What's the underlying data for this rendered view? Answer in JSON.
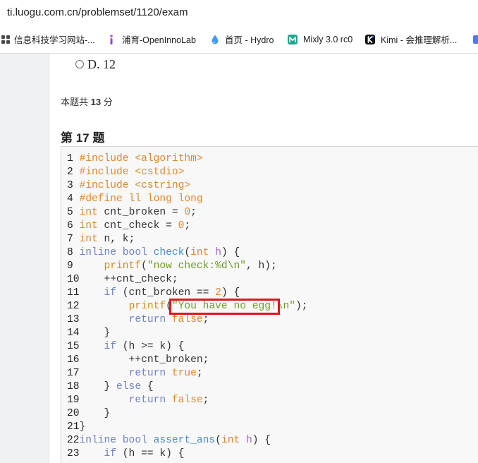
{
  "browser": {
    "url": "ti.luogu.com.cn/problemset/1120/exam",
    "bookmarks": [
      {
        "icon": "site-favicon-icon",
        "label": "信息科技学习网站-..."
      },
      {
        "icon": "i-logo-icon",
        "label": "浦育-OpenInnoLab"
      },
      {
        "icon": "droplet-icon",
        "label": "首页 - Hydro"
      },
      {
        "icon": "mixly-logo-icon",
        "label": "Mixly 3.0 rc0"
      },
      {
        "icon": "kimi-k-icon",
        "label": "Kimi - 会推理解析..."
      },
      {
        "icon": "partial-bookmark-icon"
      }
    ]
  },
  "previous_question": {
    "option_d_label": "D. 12",
    "score_prefix": "本题共",
    "score_value": "13",
    "score_suffix": "分"
  },
  "question": {
    "title": "第 17 题",
    "code": {
      "lines": [
        {
          "n": 1,
          "tokens": [
            {
              "pp": "#include <algorithm>"
            }
          ]
        },
        {
          "n": 2,
          "tokens": [
            {
              "pp": "#include <cstdio>"
            }
          ]
        },
        {
          "n": 3,
          "tokens": [
            {
              "pp": "#include <cstring>"
            }
          ]
        },
        {
          "n": 4,
          "tokens": [
            {
              "pp": "#define ll long long"
            }
          ]
        },
        {
          "n": 5,
          "tokens": [
            {
              "type": "int"
            },
            {
              "txt": " cnt_broken = "
            },
            {
              "num": "0"
            },
            {
              "txt": ";"
            }
          ]
        },
        {
          "n": 6,
          "tokens": [
            {
              "type": "int"
            },
            {
              "txt": " cnt_check = "
            },
            {
              "num": "0"
            },
            {
              "txt": ";"
            }
          ]
        },
        {
          "n": 7,
          "tokens": [
            {
              "type": "int"
            },
            {
              "txt": " n, k;"
            }
          ]
        },
        {
          "n": 8,
          "tokens": [
            {
              "kw": "inline bool"
            },
            {
              "txt": " "
            },
            {
              "fn": "check"
            },
            {
              "txt": "("
            },
            {
              "type": "int"
            },
            {
              "txt": " "
            },
            {
              "param": "h"
            },
            {
              "txt": ") {"
            }
          ]
        },
        {
          "n": 9,
          "tokens": [
            {
              "txt": "    "
            },
            {
              "builtin": "printf"
            },
            {
              "txt": "("
            },
            {
              "str": "\"now check:%d\\n\""
            },
            {
              "txt": ", h);"
            }
          ]
        },
        {
          "n": 10,
          "tokens": [
            {
              "txt": "    ++cnt_check;"
            }
          ]
        },
        {
          "n": 11,
          "tokens": [
            {
              "txt": "    "
            },
            {
              "kw": "if"
            },
            {
              "txt": " (cnt_broken == "
            },
            {
              "num": "2"
            },
            {
              "txt": ") {"
            }
          ]
        },
        {
          "n": 12,
          "tokens": [
            {
              "txt": "        "
            },
            {
              "builtin": "printf"
            },
            {
              "txt": "("
            },
            {
              "str": "\"You have no egg!\\n\""
            },
            {
              "txt": ");"
            }
          ]
        },
        {
          "n": 13,
          "tokens": [
            {
              "txt": "        "
            },
            {
              "kw": "return"
            },
            {
              "txt": " "
            },
            {
              "lit": "false"
            },
            {
              "txt": ";"
            }
          ]
        },
        {
          "n": 14,
          "tokens": [
            {
              "txt": "    }"
            }
          ]
        },
        {
          "n": 15,
          "tokens": [
            {
              "txt": "    "
            },
            {
              "kw": "if"
            },
            {
              "txt": " (h >= k) {"
            }
          ]
        },
        {
          "n": 16,
          "tokens": [
            {
              "txt": "        ++cnt_broken;"
            }
          ]
        },
        {
          "n": 17,
          "tokens": [
            {
              "txt": "        "
            },
            {
              "kw": "return"
            },
            {
              "txt": " "
            },
            {
              "lit": "true"
            },
            {
              "txt": ";"
            }
          ]
        },
        {
          "n": 18,
          "tokens": [
            {
              "txt": "    } "
            },
            {
              "kw": "else"
            },
            {
              "txt": " {"
            }
          ]
        },
        {
          "n": 19,
          "tokens": [
            {
              "txt": "        "
            },
            {
              "kw": "return"
            },
            {
              "txt": " "
            },
            {
              "lit": "false"
            },
            {
              "txt": ";"
            }
          ]
        },
        {
          "n": 20,
          "tokens": [
            {
              "txt": "    }"
            }
          ]
        },
        {
          "n": 21,
          "tokens": [
            {
              "txt": "}"
            }
          ]
        },
        {
          "n": 22,
          "tokens": [
            {
              "kw": "inline bool"
            },
            {
              "txt": " "
            },
            {
              "fn": "assert_ans"
            },
            {
              "txt": "("
            },
            {
              "type": "int"
            },
            {
              "txt": " "
            },
            {
              "param": "h"
            },
            {
              "txt": ") {"
            }
          ]
        },
        {
          "n": 23,
          "tokens": [
            {
              "txt": "    "
            },
            {
              "kw": "if"
            },
            {
              "txt": " (h == k) {"
            }
          ]
        }
      ]
    }
  },
  "colors": {
    "highlight_box": "#e3141b",
    "syntax": {
      "pp": "#e0872f",
      "type": "#e0872f",
      "kw": "#6f82c6",
      "fn": "#4b8bd4",
      "param": "#a06cc8",
      "builtin": "#d08a1c",
      "str": "#6a9c24",
      "num": "#e0872f",
      "lit": "#e0872f",
      "txt": "#333333"
    }
  }
}
